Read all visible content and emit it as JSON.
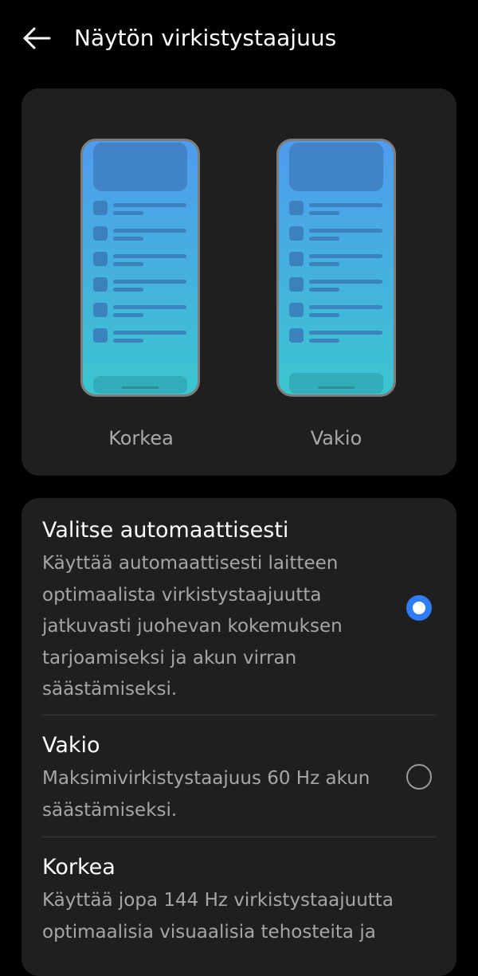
{
  "header": {
    "title": "Näytön virkistystaajuus",
    "back_icon": "arrow-left-icon"
  },
  "preview": {
    "high_label": "Korkea",
    "standard_label": "Vakio"
  },
  "options": [
    {
      "title": "Valitse automaattisesti",
      "description": "Käyttää automaattisesti laitteen optimaalista virkistystaajuutta jatkuvasti juohevan kokemuksen tarjoamiseksi ja akun virran säästämiseksi.",
      "selected": true
    },
    {
      "title": "Vakio",
      "description": "Maksimivirkistystaajuus 60 Hz akun säästämiseksi.",
      "selected": false
    },
    {
      "title": "Korkea",
      "description": "Käyttää jopa 144 Hz virkistystaajuutta optimaalisia visuaalisia tehosteita ja",
      "selected": false
    }
  ],
  "colors": {
    "background": "#000000",
    "card": "#1f1f1f",
    "accent": "#2f7cf6",
    "secondary_text": "#a6a6a6"
  }
}
